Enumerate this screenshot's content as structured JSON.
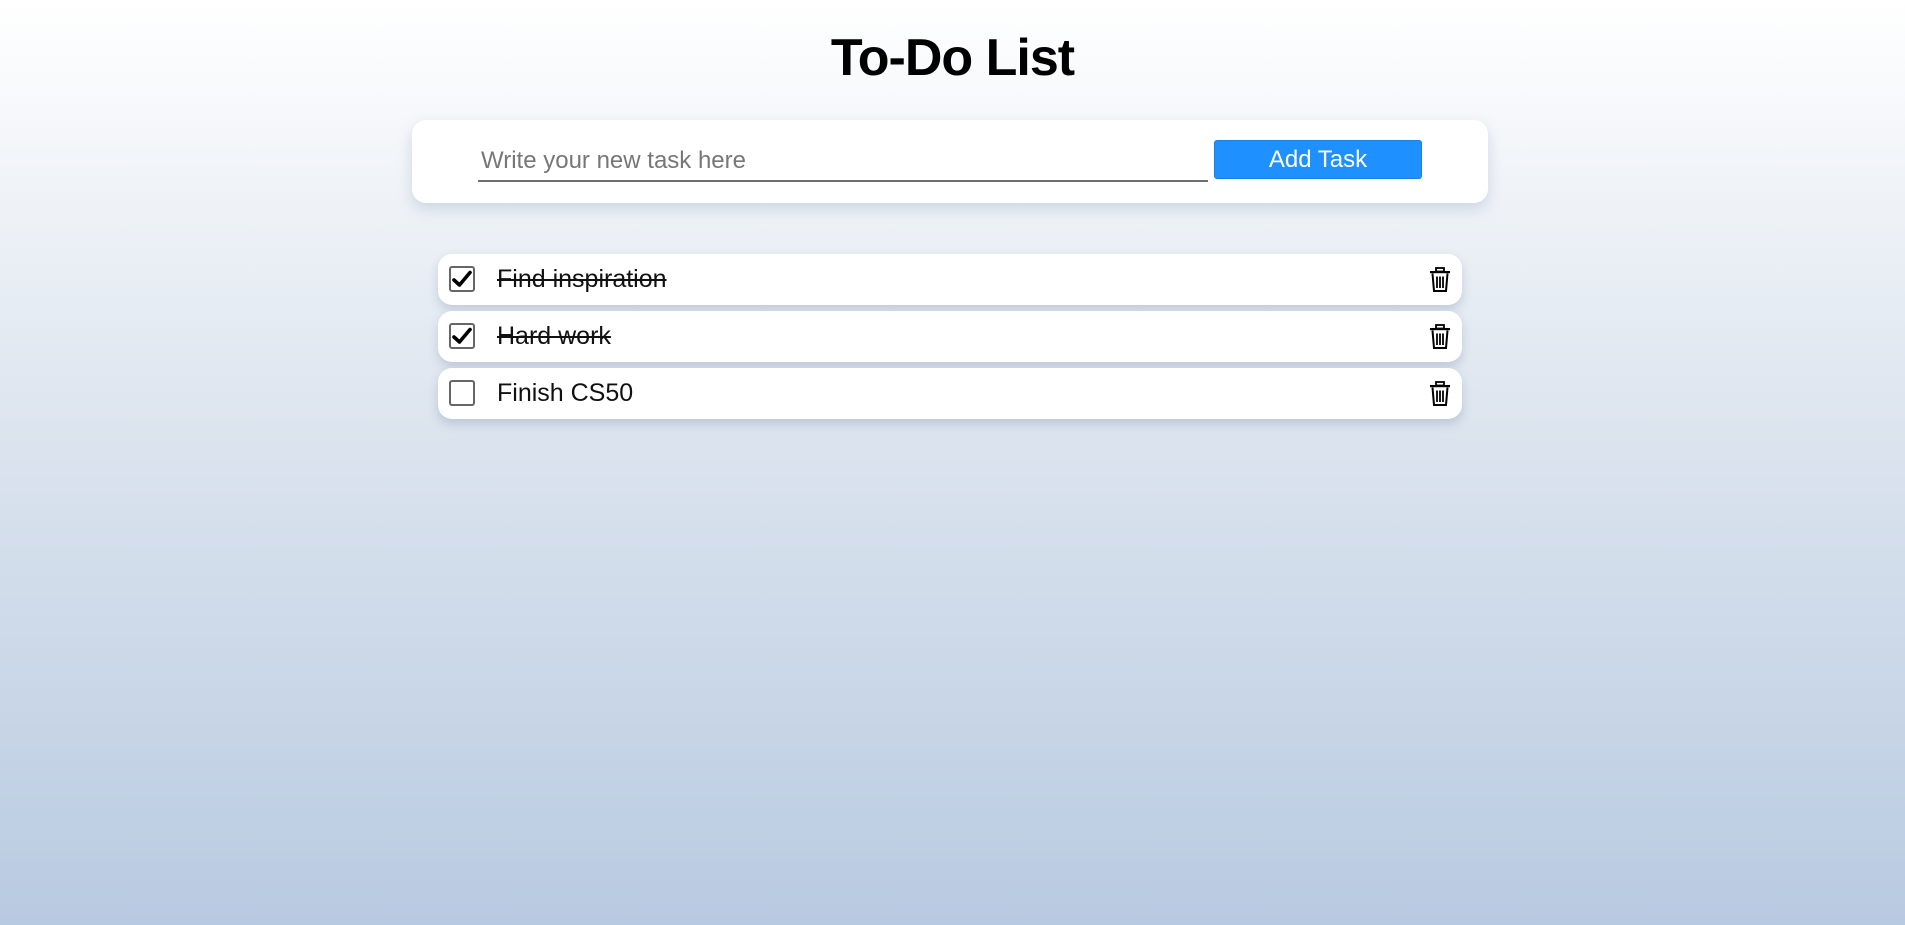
{
  "header": {
    "title": "To-Do List"
  },
  "add_form": {
    "placeholder": "Write your new task here",
    "value": "",
    "button_label": "Add Task"
  },
  "tasks": [
    {
      "text": "Find inspiration",
      "done": true
    },
    {
      "text": "Hard work",
      "done": true
    },
    {
      "text": "Finish CS50",
      "done": false
    }
  ],
  "colors": {
    "accent": "#1e90ff",
    "background_top": "#ffffff",
    "background_bottom": "#b8cae1"
  },
  "icons": {
    "check": "checkmark-icon",
    "delete": "trash-icon"
  }
}
